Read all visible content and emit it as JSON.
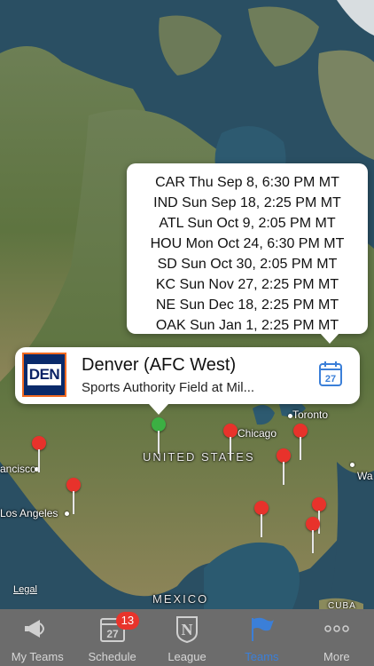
{
  "map": {
    "labels": {
      "country_us": "UNITED STATES",
      "country_mx": "MEXICO",
      "city_toronto": "Toronto",
      "city_chicago": "Chicago",
      "city_sf": "ancisco",
      "city_la": "Los Angeles",
      "city_wa": "Wa",
      "city_cuba": "CUBA"
    },
    "legal": "Legal",
    "pin_colors": {
      "selected": "#3cb043",
      "other": "#e8322b"
    }
  },
  "schedule": {
    "games": [
      "CAR Thu Sep 8, 6:30 PM MT",
      "IND Sun Sep 18, 2:25 PM MT",
      "ATL Sun Oct 9, 2:05 PM MT",
      "HOU Mon Oct 24, 6:30 PM MT",
      "SD Sun Oct 30, 2:05 PM MT",
      "KC Sun Nov 27, 2:25 PM MT",
      "NE Sun Dec 18, 2:25 PM MT",
      "OAK Sun Jan 1, 2:25 PM MT"
    ]
  },
  "callout": {
    "logo_text": "DEN",
    "team_name": "Denver (AFC West)",
    "venue": "Sports Authority Field at Mil...",
    "calendar_day": "27"
  },
  "tabs": [
    {
      "label": "My Teams",
      "icon": "megaphone-icon"
    },
    {
      "label": "Schedule",
      "icon": "calendar-icon",
      "icon_text": "27",
      "badge": "13"
    },
    {
      "label": "League",
      "icon": "league-logo-icon",
      "icon_text": "N"
    },
    {
      "label": "Teams",
      "icon": "flag-icon",
      "active": true
    },
    {
      "label": "More",
      "icon": "more-dots-icon"
    }
  ],
  "colors": {
    "accent": "#3b7fd8",
    "badge": "#e8342b",
    "tabbar": "#6c6c6c"
  }
}
